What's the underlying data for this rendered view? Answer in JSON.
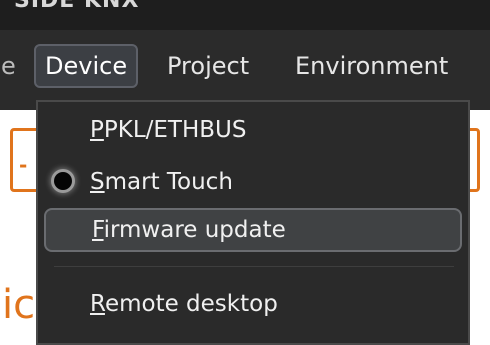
{
  "window": {
    "title": "SIDE KNX"
  },
  "menubar": {
    "cut_item": "e",
    "items": [
      {
        "label": "Device",
        "active": true
      },
      {
        "label": "Project",
        "active": false
      },
      {
        "label": "Environment",
        "active": false
      }
    ]
  },
  "background": {
    "glyph": "ic",
    "dash": "-"
  },
  "dropdown": {
    "items": [
      {
        "mnemonic": "P",
        "rest": "PKL/ETHBUS",
        "checked": false,
        "highlighted": false
      },
      {
        "mnemonic": "S",
        "rest": "mart Touch",
        "checked": true,
        "highlighted": false
      },
      {
        "mnemonic": "F",
        "rest": "irmware update",
        "checked": false,
        "highlighted": true
      },
      {
        "mnemonic": "R",
        "rest": "emote desktop",
        "checked": false,
        "highlighted": false
      }
    ]
  },
  "colors": {
    "accent_orange": "#e0741c",
    "menu_bg": "#2b2b2b",
    "dropdown_bg": "#2a2a2a",
    "highlight_bg": "#404244"
  }
}
